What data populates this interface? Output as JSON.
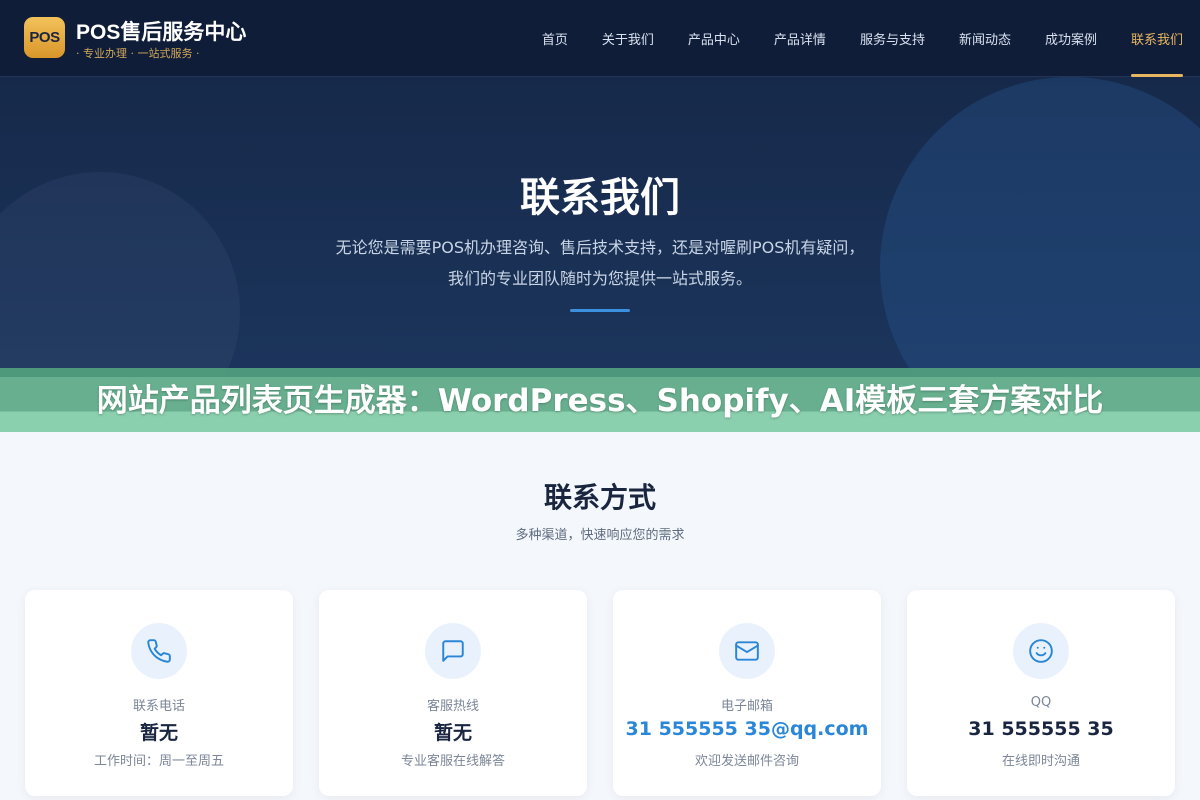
{
  "header": {
    "logo_text": "POS",
    "site_title": "POS售后服务中心",
    "site_subtitle": "· 专业办理 · 一站式服务 ·",
    "nav": [
      {
        "label": "首页"
      },
      {
        "label": "关于我们"
      },
      {
        "label": "产品中心"
      },
      {
        "label": "产品详情"
      },
      {
        "label": "服务与支持"
      },
      {
        "label": "新闻动态"
      },
      {
        "label": "成功案例"
      },
      {
        "label": "联系我们",
        "active": true
      }
    ]
  },
  "hero": {
    "title": "联系我们",
    "desc_line1": "无论您是需要POS机办理咨询、售后技术支持，还是对喔刷POS机有疑问，",
    "desc_line2": "我们的专业团队随时为您提供一站式服务。"
  },
  "banner": {
    "text": "网站产品列表页生成器：WordPress、Shopify、AI模板三套方案对比"
  },
  "contact": {
    "title": "联系方式",
    "subtitle": "多种渠道，快速响应您的需求",
    "cards": [
      {
        "icon": "phone-icon",
        "label": "联系电话",
        "value": "暂无",
        "note": "工作时间：周一至周五"
      },
      {
        "icon": "chat-icon",
        "label": "客服热线",
        "value": "暂无",
        "note": "专业客服在线解答"
      },
      {
        "icon": "mail-icon",
        "label": "电子邮箱",
        "value": "31 555555 35@qq.com",
        "note": "欢迎发送邮件咨询"
      },
      {
        "icon": "smile-icon",
        "label": "QQ",
        "value": "31 555555 35",
        "note": "在线即时沟通"
      }
    ]
  },
  "colors": {
    "header_bg": "#0f1d38",
    "accent_gold": "#e8b660",
    "accent_blue": "#2a86d6",
    "banner_green": "#54a580"
  }
}
